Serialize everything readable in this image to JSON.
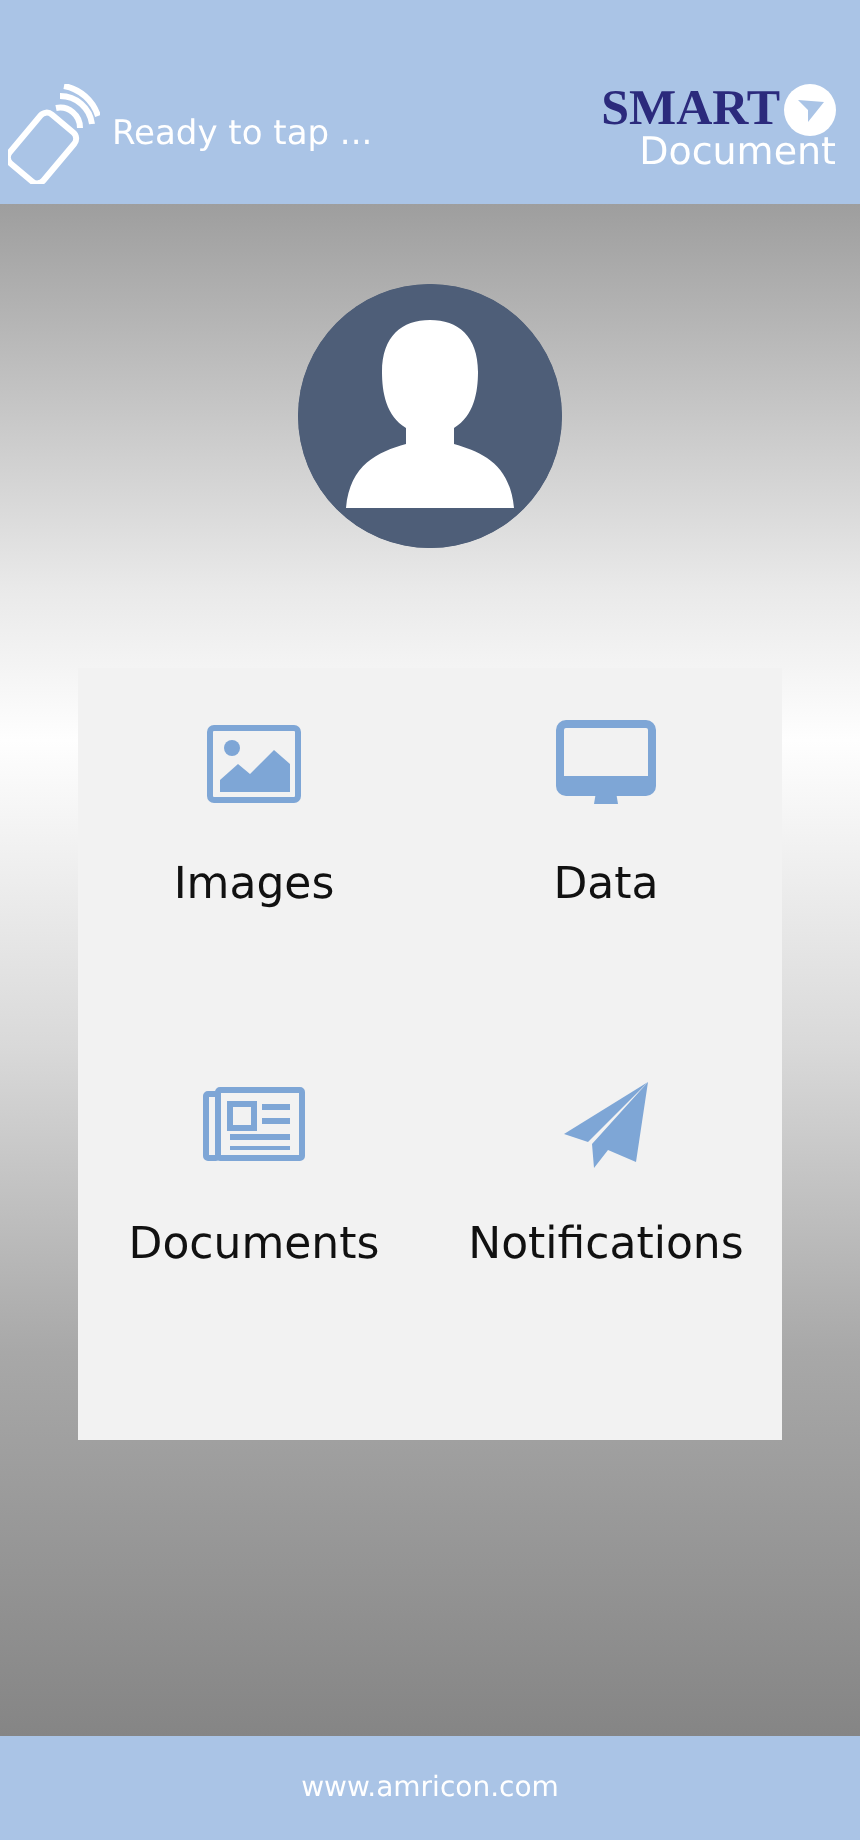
{
  "header": {
    "status": "Ready to tap ...",
    "logo": {
      "word": "SMART",
      "subword": "Document"
    }
  },
  "menu": [
    {
      "label": "Images",
      "kind": "image"
    },
    {
      "label": "Data",
      "kind": "monitor"
    },
    {
      "label": "Documents",
      "kind": "newspaper"
    },
    {
      "label": "Notifications",
      "kind": "plane"
    }
  ],
  "footer": {
    "text": "www.amricon.com"
  }
}
